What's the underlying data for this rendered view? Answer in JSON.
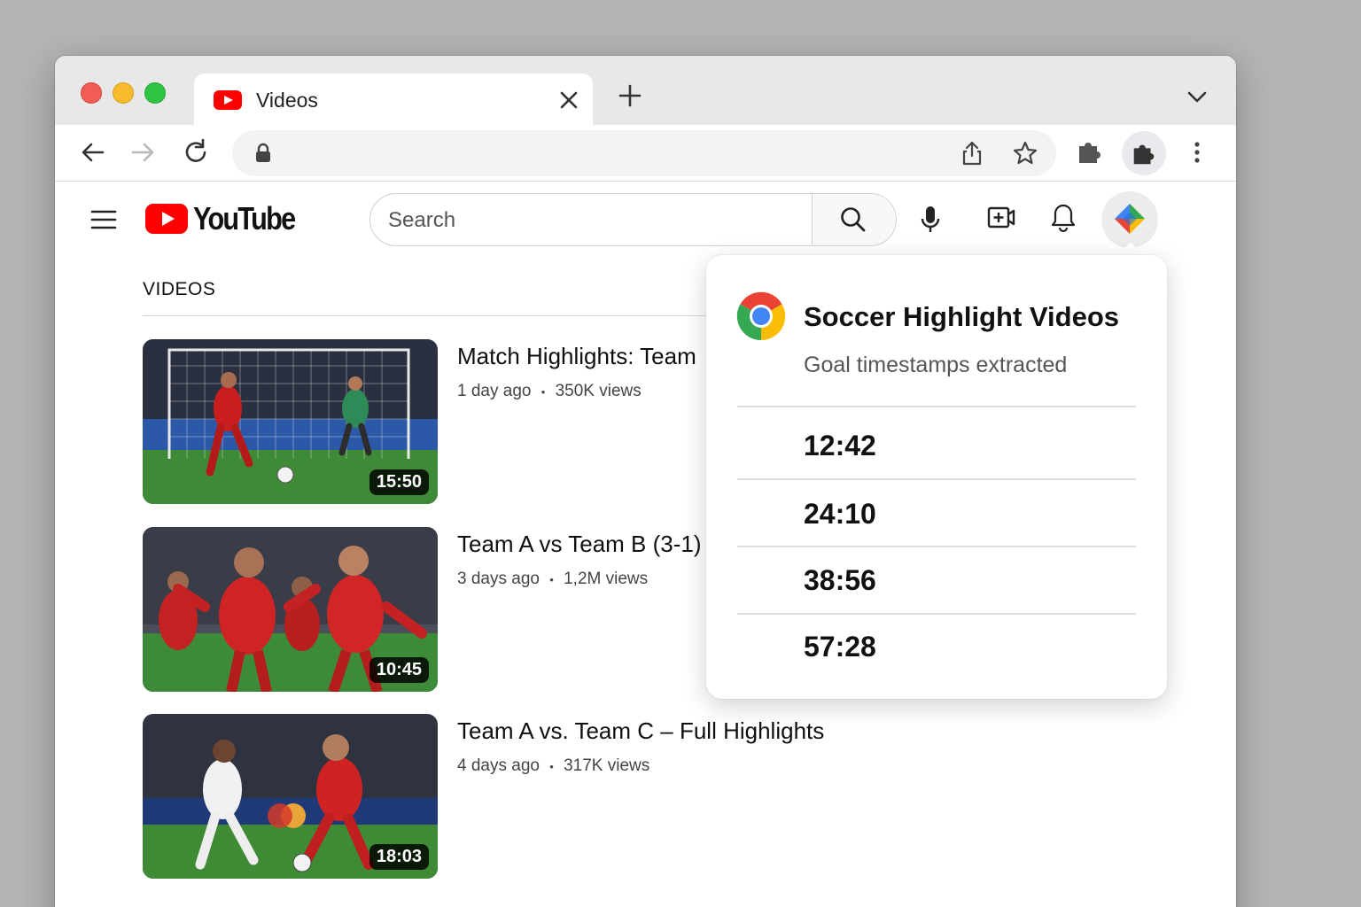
{
  "browser": {
    "tab_title": "Videos"
  },
  "youtube": {
    "logo_text": "YouTube",
    "search_placeholder": "Search",
    "section_title": "VIDEOS",
    "videos": [
      {
        "title": "Match Highlights: Team",
        "age": "1 day ago",
        "views": "350K views",
        "duration": "15:50"
      },
      {
        "title": "Team A vs Team B (3-1)",
        "age": "3 days ago",
        "views": "1,2M views",
        "duration": "10:45"
      },
      {
        "title": "Team A vs. Team C – Full Highlights",
        "age": "4 days ago",
        "views": "317K views",
        "duration": "18:03"
      }
    ],
    "meta_separator": "•"
  },
  "extension_popup": {
    "title": "Soccer Highlight Videos",
    "subtitle": "Goal timestamps extracted",
    "timestamps": [
      "12:42",
      "24:10",
      "38:56",
      "57:28"
    ]
  },
  "colors": {
    "youtube_red": "#ff0000",
    "window_bg": "#b4b4b2"
  }
}
